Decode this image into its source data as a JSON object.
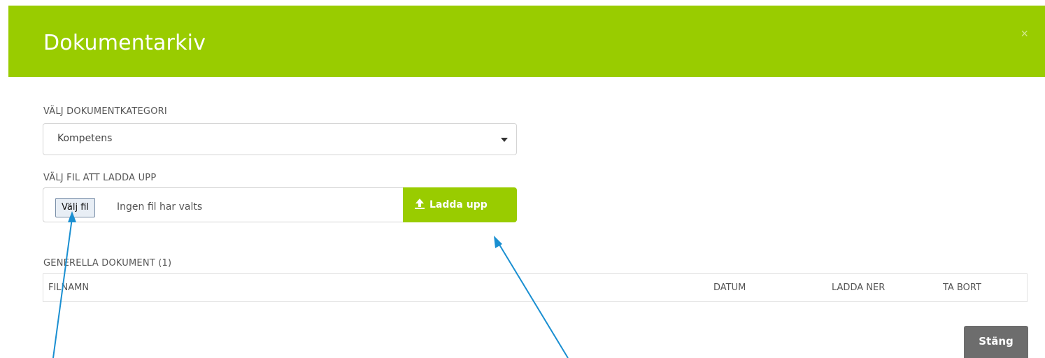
{
  "modal": {
    "title": "Dokumentarkiv",
    "close_symbol": "×",
    "header_color": "#99cc00"
  },
  "category": {
    "label": "VÄLJ DOKUMENTKATEGORI",
    "selected": "Kompetens"
  },
  "file_upload": {
    "label": "VÄLJ FIL ATT LADDA UPP",
    "choose_button": "Välj fil",
    "status": "Ingen fil har valts",
    "upload_button": "Ladda upp",
    "upload_icon": "upload-icon"
  },
  "documents": {
    "heading": "GENERELLA DOKUMENT (1)",
    "columns": [
      "FILNAMN",
      "DATUM",
      "LADDA NER",
      "TA BORT"
    ]
  },
  "footer": {
    "close_button": "Stäng"
  },
  "annotation_color": "#1a8fd1"
}
